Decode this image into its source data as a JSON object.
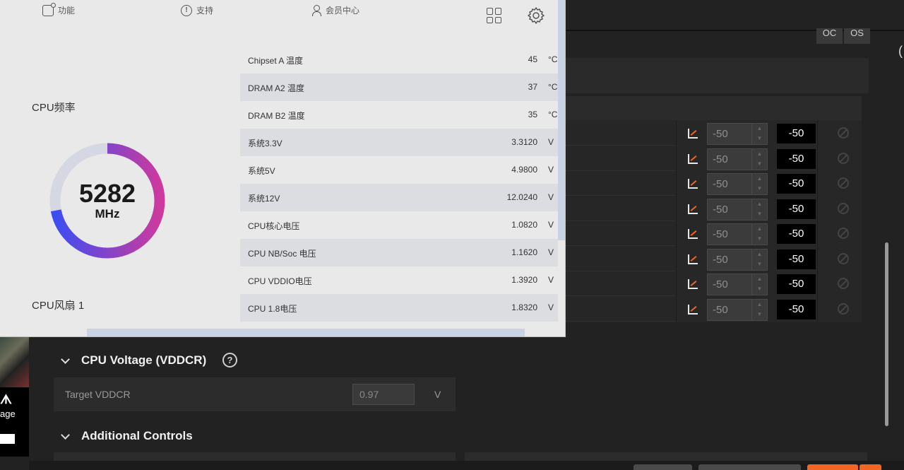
{
  "background_app": {
    "mode_buttons": [
      "OC",
      "OS"
    ],
    "core_rows": [
      {
        "spin_value": "-50",
        "value": "-50"
      },
      {
        "spin_value": "-50",
        "value": "-50"
      },
      {
        "spin_value": "-50",
        "value": "-50"
      },
      {
        "spin_value": "-50",
        "value": "-50"
      },
      {
        "spin_value": "-50",
        "value": "-50"
      },
      {
        "spin_value": "-50",
        "value": "-50"
      },
      {
        "spin_value": "-50",
        "value": "-50"
      },
      {
        "spin_value": "-50",
        "value": "-50"
      }
    ],
    "voltage_section": {
      "title": "CPU Voltage (VDDCR)",
      "help": "?",
      "target_label": "Target VDDCR",
      "target_value": "0.97",
      "target_unit": "V"
    },
    "additional_section": {
      "title": "Additional Controls"
    },
    "ad": {
      "logo": "ᗑ",
      "text": "age"
    }
  },
  "overlay": {
    "nav": [
      {
        "label": "功能",
        "icon": "function-icon"
      },
      {
        "label": "支持",
        "icon": "support-icon"
      },
      {
        "label": "会员中心",
        "icon": "member-icon"
      }
    ],
    "cpu_freq": {
      "label": "CPU频率",
      "value": "5282",
      "unit": "MHz",
      "fraction": 0.72
    },
    "cpu_fan": {
      "label": "CPU风扇 1"
    },
    "sensors": [
      {
        "name": "Chipset A 温度",
        "value": "45",
        "unit": "°C"
      },
      {
        "name": "DRAM A2 温度",
        "value": "37",
        "unit": "°C"
      },
      {
        "name": "DRAM B2 温度",
        "value": "35",
        "unit": "°C"
      },
      {
        "name": "系统3.3V",
        "value": "3.3120",
        "unit": "V"
      },
      {
        "name": "系统5V",
        "value": "4.9800",
        "unit": "V"
      },
      {
        "name": "系统12V",
        "value": "12.0240",
        "unit": "V"
      },
      {
        "name": "CPU核心电压",
        "value": "1.0820",
        "unit": "V"
      },
      {
        "name": "CPU NB/Soc 电压",
        "value": "1.1620",
        "unit": "V"
      },
      {
        "name": "CPU VDDIO电压",
        "value": "1.3920",
        "unit": "V"
      },
      {
        "name": "CPU 1.8电压",
        "value": "1.8320",
        "unit": "V"
      }
    ]
  },
  "colors": {
    "gauge_start": "#3d4df2",
    "gauge_end": "#cc3a9e",
    "gauge_track": "#d5d8e3",
    "accent_orange": "#f26522"
  }
}
